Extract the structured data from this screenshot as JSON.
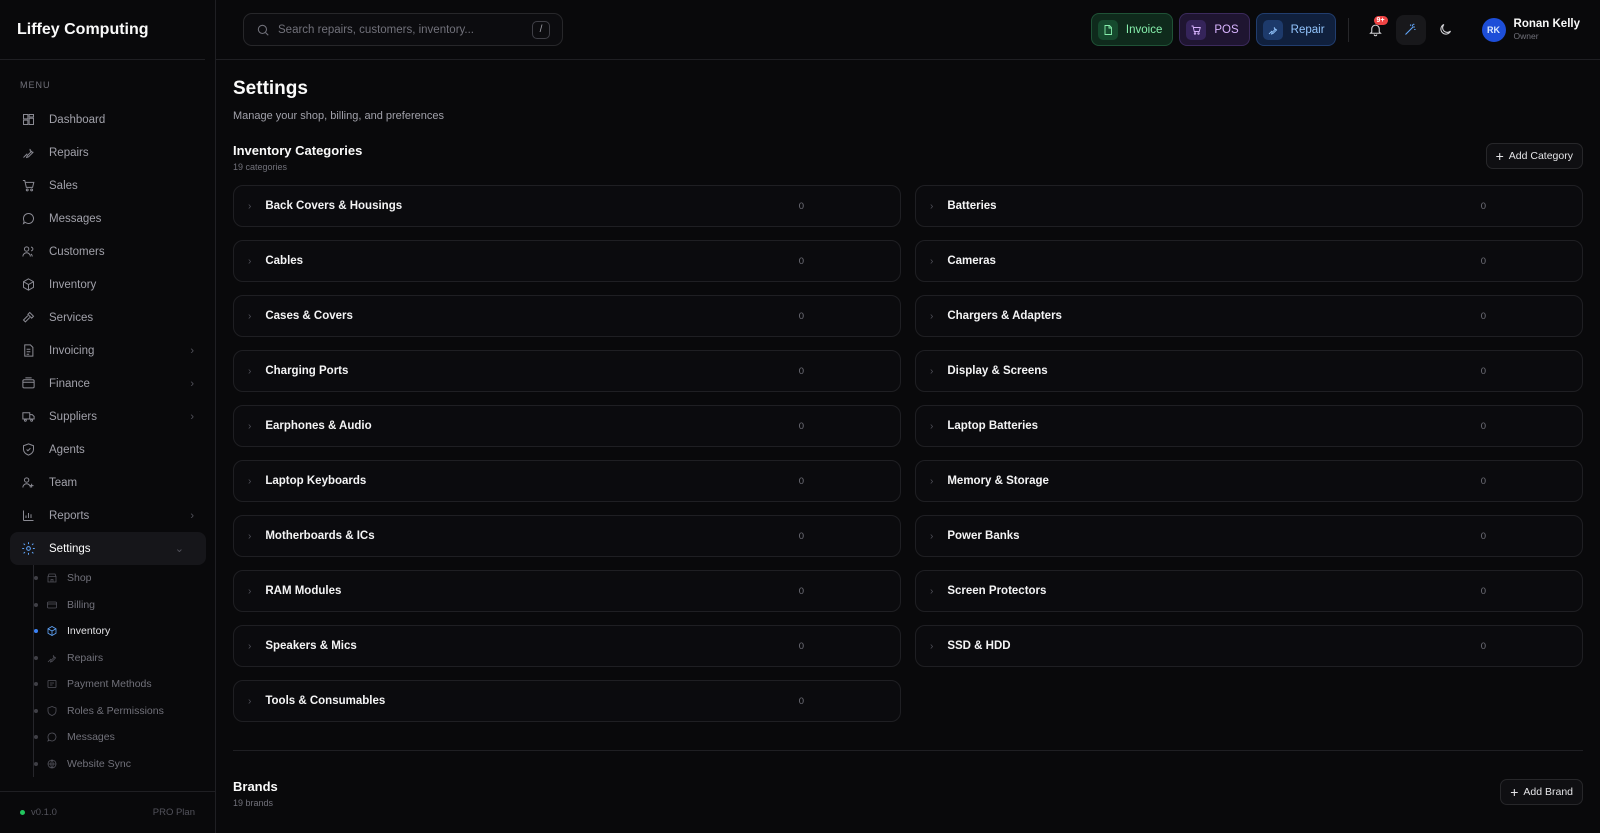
{
  "app": {
    "name": "Liffey Computing",
    "version": "v0.1.0",
    "plan": "PRO Plan"
  },
  "sidebar": {
    "menu_label": "MENU",
    "items": [
      {
        "label": "Dashboard",
        "icon": "dashboard-icon"
      },
      {
        "label": "Repairs",
        "icon": "wrench-icon"
      },
      {
        "label": "Sales",
        "icon": "cart-icon"
      },
      {
        "label": "Messages",
        "icon": "message-icon"
      },
      {
        "label": "Customers",
        "icon": "users-icon"
      },
      {
        "label": "Inventory",
        "icon": "box-icon"
      },
      {
        "label": "Services",
        "icon": "hammer-icon"
      },
      {
        "label": "Invoicing",
        "icon": "invoice-icon",
        "expandable": true
      },
      {
        "label": "Finance",
        "icon": "wallet-icon",
        "expandable": true
      },
      {
        "label": "Suppliers",
        "icon": "truck-icon",
        "expandable": true
      },
      {
        "label": "Agents",
        "icon": "agent-icon"
      },
      {
        "label": "Team",
        "icon": "team-icon"
      },
      {
        "label": "Reports",
        "icon": "chart-icon",
        "expandable": true
      },
      {
        "label": "Settings",
        "icon": "gear-icon",
        "expanded": true,
        "active": true
      }
    ],
    "sub_items": [
      {
        "label": "Shop",
        "icon": "store-icon"
      },
      {
        "label": "Billing",
        "icon": "card-icon"
      },
      {
        "label": "Inventory",
        "icon": "box-icon",
        "active": true
      },
      {
        "label": "Repairs",
        "icon": "wrench-icon"
      },
      {
        "label": "Payment Methods",
        "icon": "payment-icon"
      },
      {
        "label": "Roles & Permissions",
        "icon": "shield-icon"
      },
      {
        "label": "Messages",
        "icon": "message-icon"
      },
      {
        "label": "Website Sync",
        "icon": "globe-icon"
      }
    ]
  },
  "topbar": {
    "search_placeholder": "Search repairs, customers, inventory...",
    "search_shortcut": "/",
    "actions": {
      "invoice": "Invoice",
      "pos": "POS",
      "repair": "Repair"
    },
    "notification_badge": "9+",
    "user": {
      "initials": "RK",
      "name": "Ronan Kelly",
      "role": "Owner"
    }
  },
  "page": {
    "title": "Settings",
    "subtitle": "Manage your shop, billing, and preferences"
  },
  "categories": {
    "title": "Inventory Categories",
    "count_label": "19 categories",
    "add_label": "Add Category",
    "items": [
      {
        "name": "Back Covers & Housings",
        "count": "0"
      },
      {
        "name": "Batteries",
        "count": "0"
      },
      {
        "name": "Cables",
        "count": "0"
      },
      {
        "name": "Cameras",
        "count": "0"
      },
      {
        "name": "Cases & Covers",
        "count": "0"
      },
      {
        "name": "Chargers & Adapters",
        "count": "0"
      },
      {
        "name": "Charging Ports",
        "count": "0"
      },
      {
        "name": "Display & Screens",
        "count": "0"
      },
      {
        "name": "Earphones & Audio",
        "count": "0"
      },
      {
        "name": "Laptop Batteries",
        "count": "0"
      },
      {
        "name": "Laptop Keyboards",
        "count": "0"
      },
      {
        "name": "Memory & Storage",
        "count": "0"
      },
      {
        "name": "Motherboards & ICs",
        "count": "0"
      },
      {
        "name": "Power Banks",
        "count": "0"
      },
      {
        "name": "RAM Modules",
        "count": "0"
      },
      {
        "name": "Screen Protectors",
        "count": "0"
      },
      {
        "name": "Speakers & Mics",
        "count": "0"
      },
      {
        "name": "SSD & HDD",
        "count": "0"
      },
      {
        "name": "Tools & Consumables",
        "count": "0"
      }
    ]
  },
  "brands": {
    "title": "Brands",
    "count_label": "19 brands",
    "add_label": "Add Brand"
  }
}
